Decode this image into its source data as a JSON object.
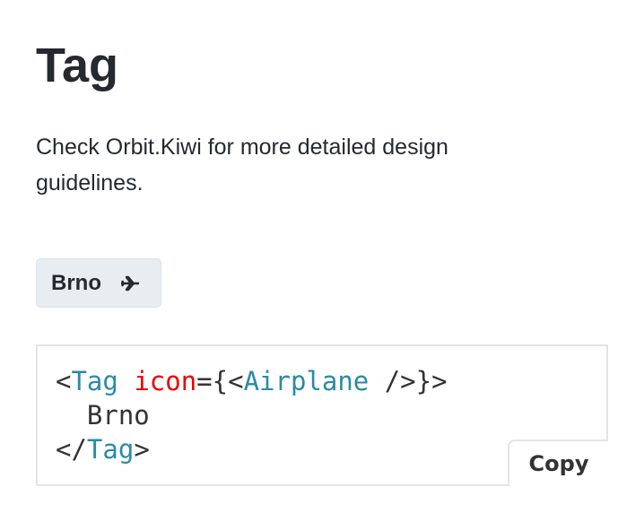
{
  "page": {
    "title": "Tag",
    "description": "Check Orbit.Kiwi for more detailed design guidelines."
  },
  "example": {
    "tag_label": "Brno",
    "tag_icon": "airplane-icon",
    "tag_bg": "#e8edf1"
  },
  "code": {
    "line1": {
      "open": "<",
      "tag": "Tag",
      "space": " ",
      "attr": "icon",
      "eq": "={<",
      "comp": "Airplane",
      "close": " />}>"
    },
    "line2": "  Brno",
    "line3": {
      "open": "</",
      "tag": "Tag",
      "close": ">"
    },
    "copy_label": "Copy",
    "tag_color": "#2a8ba8",
    "attr_color": "#ee0000"
  }
}
